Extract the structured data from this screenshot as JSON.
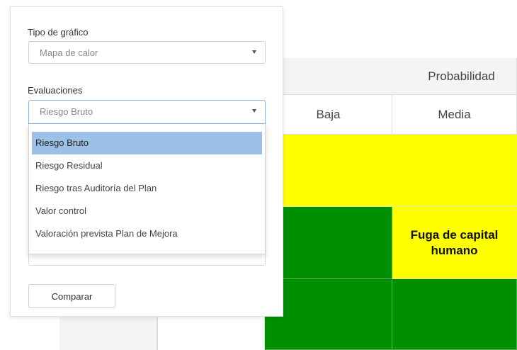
{
  "filters": {
    "chart_type": {
      "label": "Tipo de gráfico",
      "value": "Mapa de calor"
    },
    "evaluations": {
      "label": "Evaluaciones",
      "value": "Riesgo Bruto",
      "options": [
        "Riesgo Bruto",
        "Riesgo Residual",
        "Riesgo tras Auditoría del Plan",
        "Valor control",
        "Valoración prevista Plan de Mejora"
      ],
      "selected_index": 0
    },
    "compare_label": "Comparar"
  },
  "heatmap": {
    "axis_title": "Probabilidad",
    "columns": [
      "Baja",
      "Media"
    ],
    "risk_label_line1": "Fuga de capital",
    "risk_label_line2": "humano",
    "colors": {
      "high": "#ffff00",
      "low": "#008f00",
      "header": "#f4f4f4",
      "selected_option": "#9cc0e6"
    }
  }
}
